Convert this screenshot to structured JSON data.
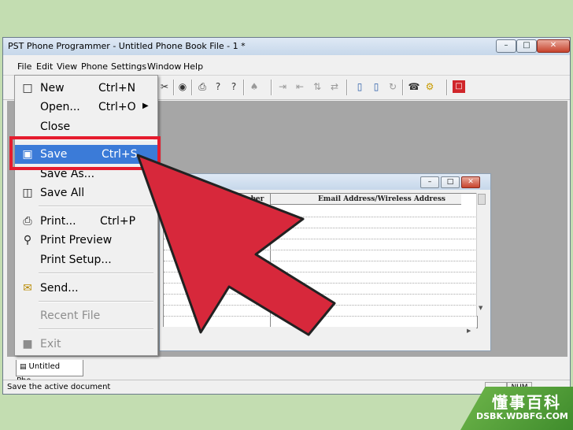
{
  "window": {
    "title": "PST Phone Programmer - Untitled Phone Book File - 1 *"
  },
  "menubar": {
    "items": [
      "File",
      "Edit",
      "View",
      "Phone",
      "Settings",
      "Window",
      "Help"
    ]
  },
  "toolbar": {
    "icons": [
      "new-icon",
      "open-icon",
      "save-icon",
      "cut-icon",
      "copy-icon",
      "paste-icon",
      "find-icon",
      "print-icon",
      "help-icon",
      "context-help-icon",
      "user-icon",
      "import-icon",
      "export-icon",
      "merge-icon",
      "phone-read-icon",
      "phone-write-icon",
      "sync-icon",
      "phone-icon",
      "phone-settings-icon",
      "pdf-icon"
    ]
  },
  "child_window": {
    "columns": [
      "Phone Number",
      "Email Address/Wireless Address"
    ]
  },
  "file_menu": {
    "items": [
      {
        "label": "New",
        "shortcut": "Ctrl+N",
        "icon": "new-document-icon",
        "enabled": true
      },
      {
        "label": "Open...",
        "shortcut": "Ctrl+O",
        "icon": "",
        "enabled": true,
        "submenu": true
      },
      {
        "label": "Close",
        "shortcut": "",
        "icon": "",
        "enabled": true
      },
      {
        "label": "Save",
        "shortcut": "Ctrl+S",
        "icon": "floppy-disk-icon",
        "enabled": true,
        "highlighted": true
      },
      {
        "label": "Save As...",
        "shortcut": "",
        "icon": "",
        "enabled": true
      },
      {
        "label": "Save All",
        "shortcut": "",
        "icon": "save-all-icon",
        "enabled": true
      },
      {
        "label": "Print...",
        "shortcut": "Ctrl+P",
        "icon": "printer-icon",
        "enabled": true
      },
      {
        "label": "Print Preview",
        "shortcut": "",
        "icon": "print-preview-icon",
        "enabled": true
      },
      {
        "label": "Print Setup...",
        "shortcut": "",
        "icon": "",
        "enabled": true
      },
      {
        "label": "Send...",
        "shortcut": "",
        "icon": "envelope-icon",
        "enabled": true
      },
      {
        "label": "Recent File",
        "shortcut": "",
        "icon": "",
        "enabled": false
      },
      {
        "label": "Exit",
        "shortcut": "",
        "icon": "exit-icon",
        "enabled": false
      }
    ]
  },
  "tab": {
    "label": "Untitled Pho..."
  },
  "statusbar": {
    "text": "Save the active document",
    "num": "NUM"
  },
  "watermark": {
    "cn": "懂事百科",
    "en": "DSBK.WDBFG.COM"
  },
  "colors": {
    "highlight": "#3b7bd8",
    "annotation": "#e51c2e",
    "arrow": "#d7283b"
  }
}
